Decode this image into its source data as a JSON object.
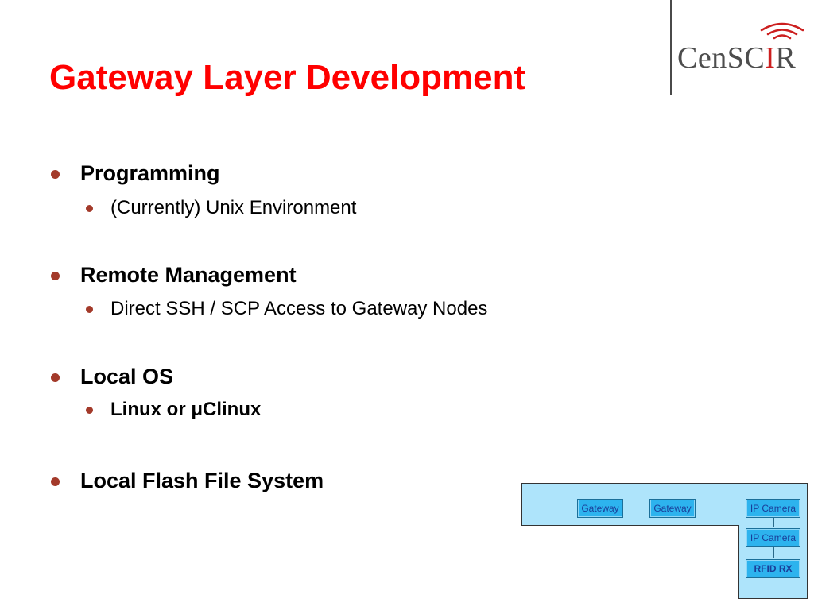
{
  "slide": {
    "title": "Gateway Layer Development"
  },
  "logo": {
    "text_main": "CenSC",
    "text_accent": "I",
    "text_end": "R"
  },
  "bullets": [
    {
      "label": "Programming",
      "sub": [
        "(Currently) Unix Environment"
      ]
    },
    {
      "label": "Remote Management",
      "sub": [
        "Direct SSH / SCP Access to Gateway Nodes"
      ]
    },
    {
      "label": "Local OS",
      "sub": [
        "Linux or μClinux"
      ]
    },
    {
      "label": "Local Flash File System",
      "sub": []
    }
  ],
  "diagram": {
    "nodes": [
      "Gateway",
      "Gateway",
      "IP Camera",
      "IP Camera",
      "RFID RX"
    ],
    "fill_color": "#aee4fb",
    "node_color": "#2db3ee"
  }
}
